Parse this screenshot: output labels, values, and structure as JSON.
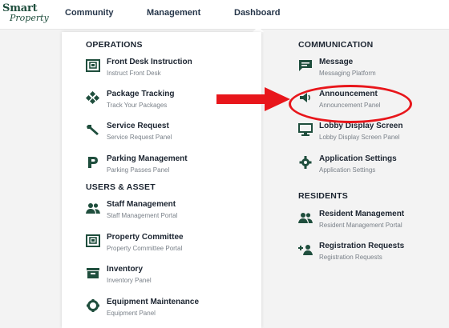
{
  "logo": {
    "line1": "Smart",
    "line2": "Property"
  },
  "nav": {
    "community": "Community",
    "management": "Management",
    "dashboard": "Dashboard"
  },
  "sections": {
    "operations": "OPERATIONS",
    "users_asset": "USERS & ASSET",
    "communication": "COMMUNICATION",
    "residents": "RESIDENTS"
  },
  "operations": [
    {
      "title": "Front Desk Instruction",
      "sub": "Instruct Front Desk",
      "icon": "front-desk-icon"
    },
    {
      "title": "Package Tracking",
      "sub": "Track Your Packages",
      "icon": "package-icon"
    },
    {
      "title": "Service Request",
      "sub": "Service Request Panel",
      "icon": "wrench-icon"
    },
    {
      "title": "Parking Management",
      "sub": "Parking Passes Panel",
      "icon": "parking-icon"
    }
  ],
  "users_asset": [
    {
      "title": "Staff Management",
      "sub": "Staff Management Portal",
      "icon": "staff-icon"
    },
    {
      "title": "Property Committee",
      "sub": "Property Committee Portal",
      "icon": "committee-icon"
    },
    {
      "title": "Inventory",
      "sub": "Inventory Panel",
      "icon": "inventory-icon"
    },
    {
      "title": "Equipment Maintenance",
      "sub": "Equipment Panel",
      "icon": "gear-icon"
    }
  ],
  "communication": [
    {
      "title": "Message",
      "sub": "Messaging Platform",
      "icon": "message-icon"
    },
    {
      "title": "Announcement",
      "sub": "Announcement Panel",
      "icon": "megaphone-icon"
    },
    {
      "title": "Lobby Display Screen",
      "sub": "Lobby Display Screen Panel",
      "icon": "monitor-icon"
    },
    {
      "title": "Application Settings",
      "sub": "Application Settings",
      "icon": "settings-icon"
    }
  ],
  "residents": [
    {
      "title": "Resident Management",
      "sub": "Resident Management Portal",
      "icon": "residents-icon"
    },
    {
      "title": "Registration Requests",
      "sub": "Registration Requests",
      "icon": "add-user-icon"
    }
  ],
  "annotation": {
    "color": "#e8161b",
    "target": "Announcement"
  },
  "colors": {
    "icon": "#1f4e3d",
    "text": "#1b2430",
    "subtext": "#7a8189"
  }
}
